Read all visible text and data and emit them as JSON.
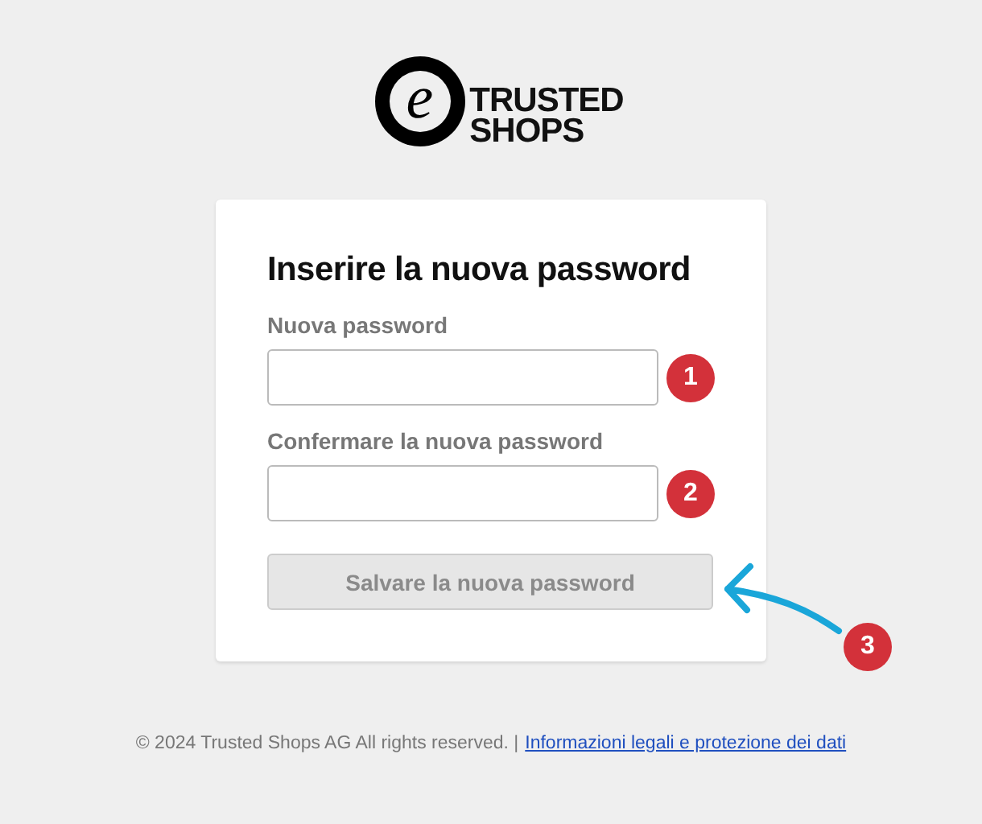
{
  "logo": {
    "mark": "e",
    "line_1": "TRUSTED",
    "line_2": "SHOPS"
  },
  "form": {
    "title": "Inserire la nuova password",
    "fields": [
      {
        "label": "Nuova password",
        "badge": "1"
      },
      {
        "label": "Confermare la nuova password",
        "badge": "2"
      }
    ],
    "submit": {
      "label": "Salvare la nuova password",
      "disabled": true,
      "badge": "3"
    }
  },
  "footer": {
    "copyright": "© 2024 Trusted Shops AG All rights reserved. |",
    "link": "Informazioni legali e protezione dei dati"
  }
}
